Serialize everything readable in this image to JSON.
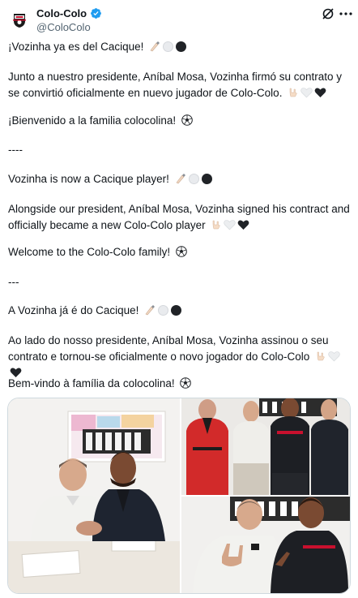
{
  "author": {
    "display_name": "Colo-Colo",
    "handle": "@ColoColo",
    "verified": true,
    "avatar_icon": "colo-colo-crest-icon"
  },
  "header_icons": [
    "grok-icon",
    "more-options-icon"
  ],
  "post": {
    "es_title": "¡Vozinha ya es del Cacique!",
    "es_body": "Junto a nuestro presidente, Aníbal Mosa, Vozinha firmó su contrato y se convirtió oficialmente en nuevo jugador de Colo-Colo.",
    "es_welcome": "¡Bienvenido a la familia colocolina!",
    "sep1": "----",
    "en_title": "Vozinha is now a Cacique player!",
    "en_body": "Alongside our president, Aníbal Mosa, Vozinha signed his contract and officially became a new Colo-Colo player",
    "en_welcome": "Welcome to the Colo-Colo family!",
    "sep2": "---",
    "pt_title": "A Vozinha já é do Cacique!",
    "pt_body": "Ao lado do nosso presidente, Aníbal Mosa, Vozinha assinou o seu contrato e tornou-se oficialmente o novo jogador do Colo-Colo",
    "pt_welcome": "Bem-vindo à família da colocolina!"
  },
  "emojis": [
    "writing-hand-icon",
    "white-circle-icon",
    "black-circle-icon",
    "rock-hand-icon",
    "white-heart-icon",
    "black-heart-icon",
    "soccer-ball-icon"
  ],
  "colors": {
    "text": "#0f1419",
    "secondary": "#536471",
    "verified": "#1d9bf0",
    "border": "#cfd9de"
  },
  "media": {
    "photos": [
      "signing-photo",
      "group-photo",
      "handshake-photo"
    ]
  }
}
